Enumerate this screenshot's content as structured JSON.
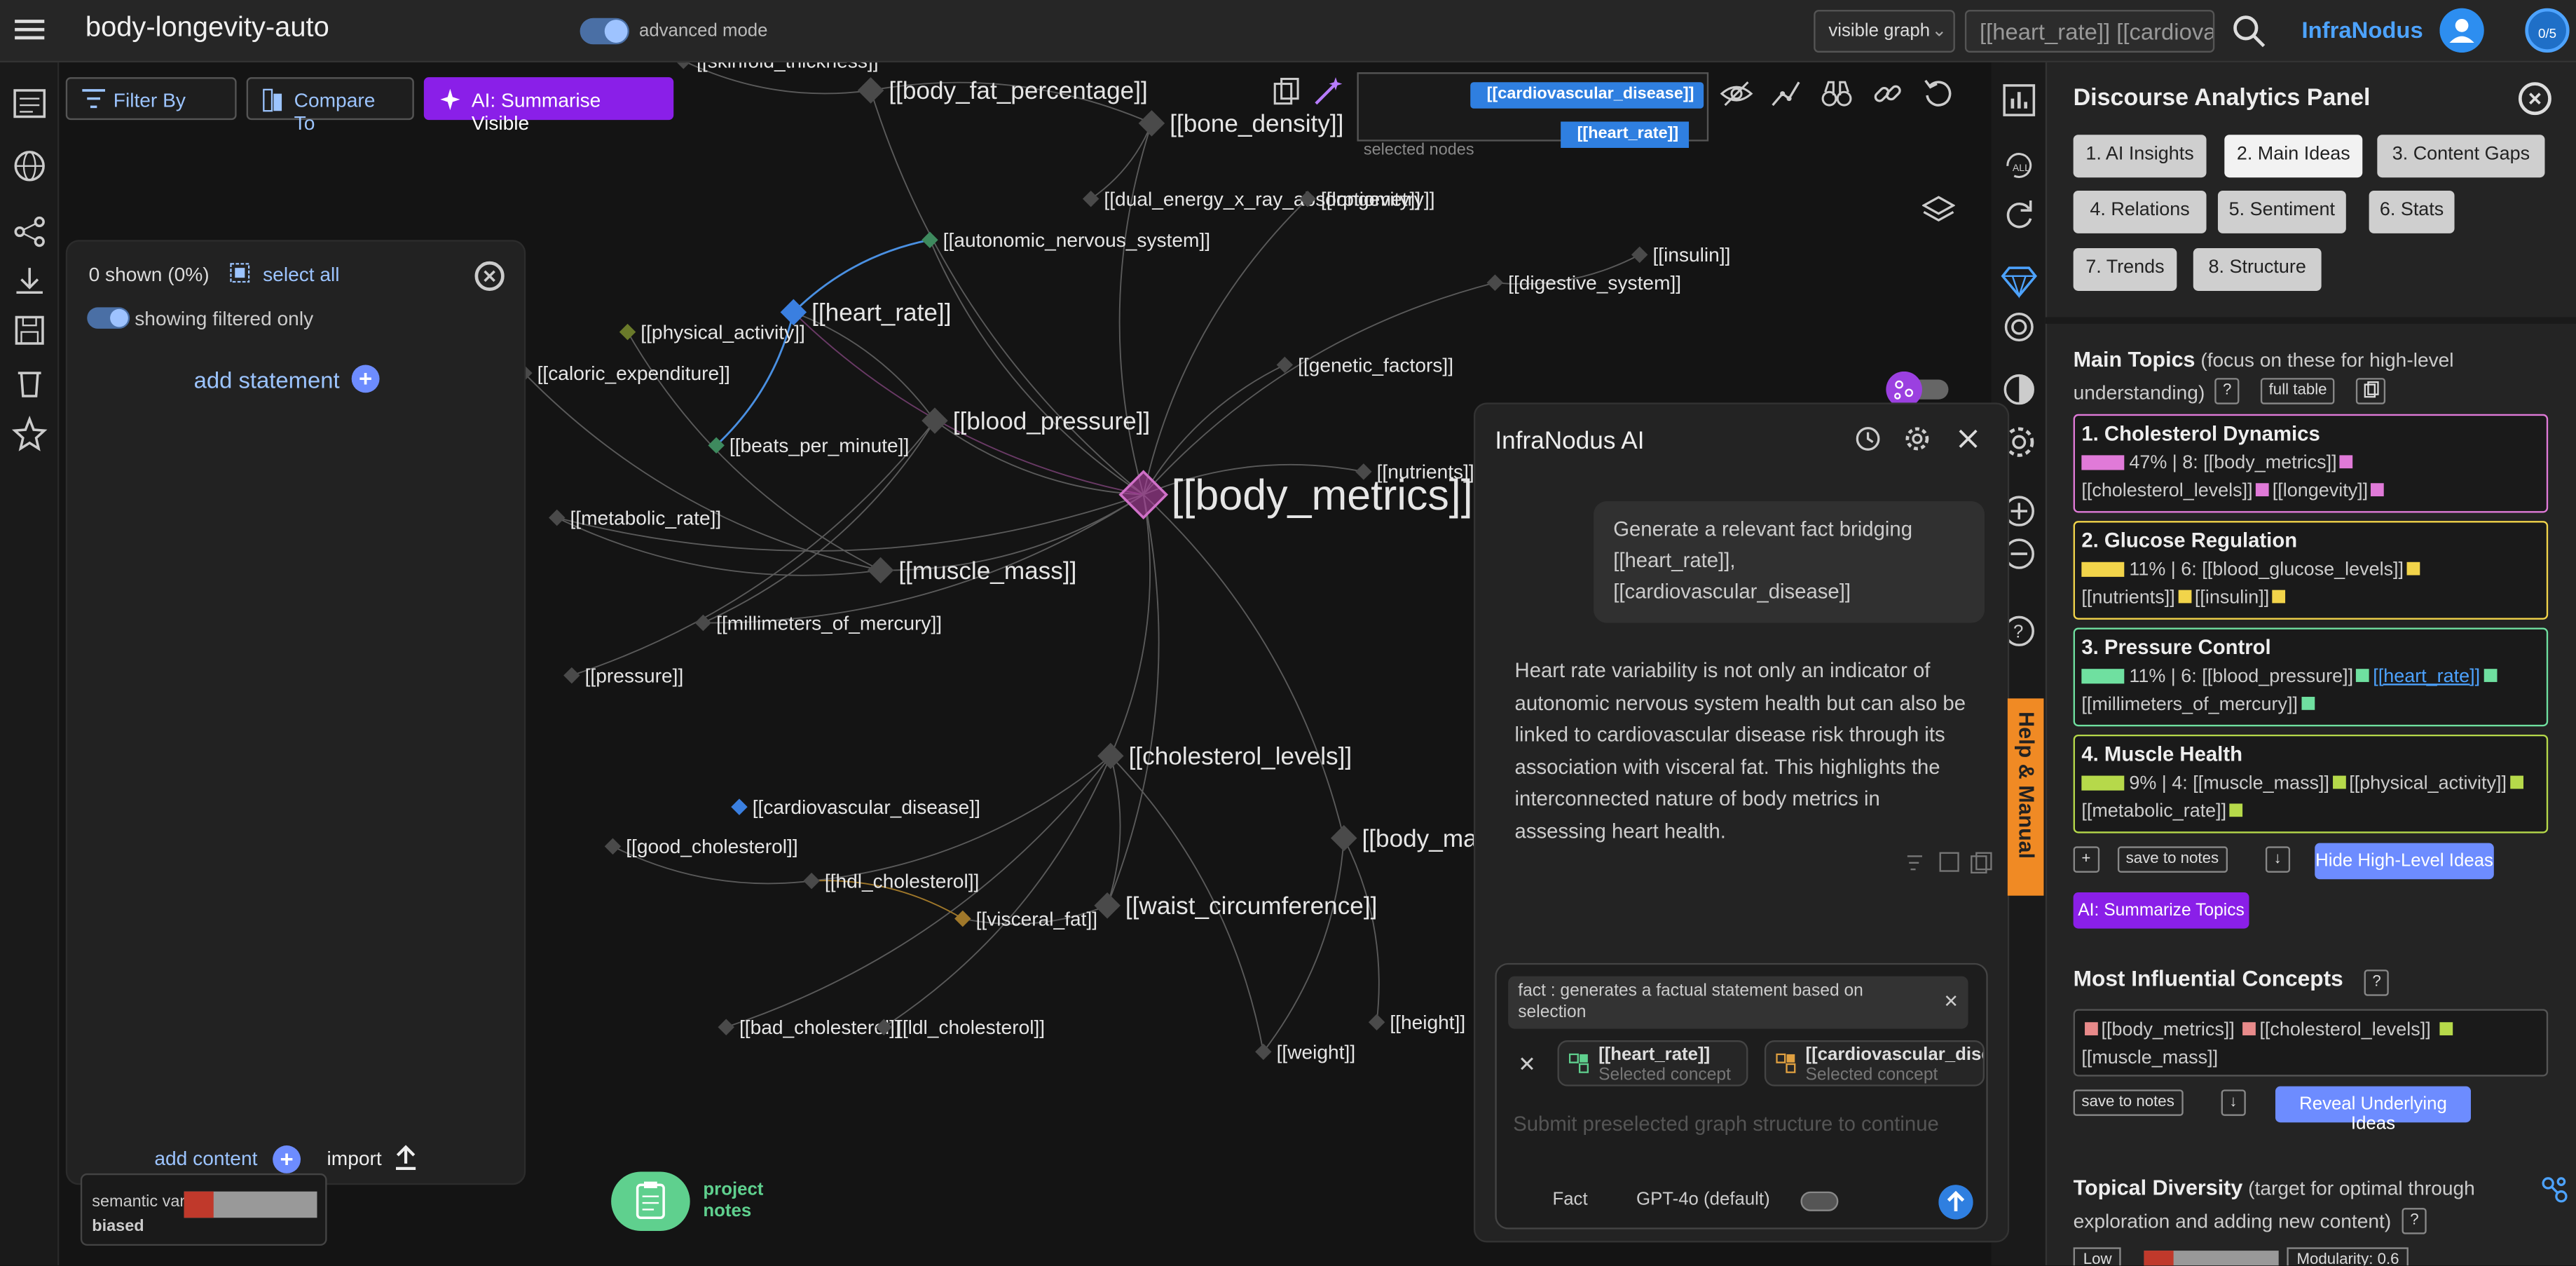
{
  "topbar": {
    "project_name": "body-longevity-auto",
    "advanced_mode_label": "advanced mode",
    "view_select": "visible graph",
    "search_value": "[[heart_rate]] [[cardiovascular_disease]]",
    "brand": "InfraNodus",
    "counter": "0/5"
  },
  "toolbar": {
    "filter_label": "Filter By",
    "compare_label": "Compare To",
    "summarise_label": "AI: Summarise Visible"
  },
  "statements": {
    "shown_count": "0 shown (0%)",
    "select_all": "select all",
    "filtered_label": "showing filtered only",
    "add_statement": "add statement",
    "add_content": "add content",
    "import": "import",
    "variability_label": "semantic variability:",
    "variability_value": "biased",
    "variability_level": 0.22
  },
  "project_notes": "project notes",
  "selected_nodes": {
    "label": "selected nodes",
    "chips": [
      "[[cardiovascular_disease]]",
      "[[heart_rate]]"
    ]
  },
  "graph": {
    "nodes": [
      {
        "label": "[[body_metrics]]",
        "color": "#b03fa2",
        "size": "xl"
      },
      {
        "label": "[[cholesterol_levels]]",
        "color": "#4a4a4a",
        "size": "l"
      },
      {
        "label": "[[muscle_mass]]",
        "color": "#4a4a4a",
        "size": "l"
      },
      {
        "label": "[[blood_pressure]]",
        "color": "#4a4a4a",
        "size": "l"
      },
      {
        "label": "[[heart_rate]]",
        "color": "#3a7fe0",
        "size": "l"
      },
      {
        "label": "[[body_fat_percentage]]",
        "color": "#4a4a4a",
        "size": "l"
      },
      {
        "label": "[[bone_density]]",
        "color": "#4a4a4a",
        "size": "l"
      },
      {
        "label": "[[waist_circumference]]",
        "color": "#4a4a4a",
        "size": "l"
      },
      {
        "label": "[[body_ma",
        "color": "#4a4a4a",
        "size": "l"
      },
      {
        "label": "[[skinfold_thickness]]",
        "color": "#4a4a4a",
        "size": "s"
      },
      {
        "label": "[[dual_energy_x_ray_absorptiometry]]",
        "color": "#4a4a4a",
        "size": "s"
      },
      {
        "label": "[[longevity]]",
        "color": "#4a4a4a",
        "size": "s"
      },
      {
        "label": "[[autonomic_nervous_system]]",
        "color": "#3e8a5e",
        "size": "s"
      },
      {
        "label": "[[insulin]]",
        "color": "#4a4a4a",
        "size": "s"
      },
      {
        "label": "[[digestive_system]]",
        "color": "#4a4a4a",
        "size": "s"
      },
      {
        "label": "[[physical_activity]]",
        "color": "#6a7a2a",
        "size": "s"
      },
      {
        "label": "[[caloric_expenditure]]",
        "color": "#4a4a4a",
        "size": "s"
      },
      {
        "label": "[[genetic_factors]]",
        "color": "#4a4a4a",
        "size": "s"
      },
      {
        "label": "[[beats_per_minute]]",
        "color": "#3e8a5e",
        "size": "s"
      },
      {
        "label": "[[nutrients]]",
        "color": "#4a4a4a",
        "size": "s"
      },
      {
        "label": "[[metabolic_rate]]",
        "color": "#4a4a4a",
        "size": "s"
      },
      {
        "label": "[[millimeters_of_mercury]]",
        "color": "#4a4a4a",
        "size": "s"
      },
      {
        "label": "[[pressure]]",
        "color": "#4a4a4a",
        "size": "s"
      },
      {
        "label": "[[cardiovascular_disease]]",
        "color": "#3a7fe0",
        "size": "s"
      },
      {
        "label": "[[good_cholesterol]]",
        "color": "#4a4a4a",
        "size": "s"
      },
      {
        "label": "[[hdl_cholesterol]]",
        "color": "#4a4a4a",
        "size": "s"
      },
      {
        "label": "[[visceral_fat]]",
        "color": "#a0782a",
        "size": "s"
      },
      {
        "label": "[[bad_cholesterol]]",
        "color": "#4a4a4a",
        "size": "s"
      },
      {
        "label": "[[ldl_cholesterol]]",
        "color": "#4a4a4a",
        "size": "s"
      },
      {
        "label": "[[height]]",
        "color": "#4a4a4a",
        "size": "s"
      },
      {
        "label": "[[weight]]",
        "color": "#4a4a4a",
        "size": "s"
      }
    ]
  },
  "ai_panel": {
    "title": "InfraNodus AI",
    "user_message": "Generate a relevant fact bridging [[heart_rate]], [[cardiovascular_disease]]",
    "response": "Heart rate variability is not only an indicator of autonomic nervous system health but can also be linked to cardiovascular disease risk through its association with visceral fat. This highlights the interconnected nature of body metrics in assessing heart health.",
    "mode_chip": "fact : generates a factual statement based on selection",
    "concepts": [
      {
        "name": "[[heart_rate]]",
        "sub": "Selected concept"
      },
      {
        "name": "[[cardiovascular_disease]]",
        "sub": "Selected concept"
      }
    ],
    "input_placeholder": "Submit preselected graph structure to continue",
    "mode_label": "Fact",
    "model_label": "GPT-4o (default)"
  },
  "help_tab": "Help & Manual",
  "analytics": {
    "title": "Discourse Analytics Panel",
    "tabs": [
      "1. AI Insights",
      "2. Main Ideas",
      "3. Content Gaps",
      "4. Relations",
      "5. Sentiment",
      "6. Stats",
      "7. Trends",
      "8. Structure"
    ],
    "main_topics_title": "Main Topics",
    "main_topics_hint": "(focus on these for high-level understanding)",
    "help_q": "?",
    "full_table": "full table",
    "topics": [
      {
        "title": "1. Cholesterol Dynamics",
        "color": "#e07ad8",
        "line1": "47% | 8: [[body_metrics]]",
        "line2": "[[cholesterol_levels]]",
        "line3": "[[longevity]]"
      },
      {
        "title": "2. Glucose Regulation",
        "color": "#f2d44a",
        "line1": "11% | 6: [[blood_glucose_levels]]",
        "line2": "[[nutrients]]",
        "line3": "[[insulin]]"
      },
      {
        "title": "3. Pressure Control",
        "color": "#6fe0a0",
        "line1": "11% | 6: [[blood_pressure]]",
        "line2": "[[heart_rate]]",
        "line3": "[[millimeters_of_mercury]]"
      },
      {
        "title": "4. Muscle Health",
        "color": "#b6d94a",
        "line1": "9% | 4: [[muscle_mass]]",
        "line2": "[[physical_activity]]",
        "line3": "[[metabolic_rate]]"
      }
    ],
    "plus": "+",
    "save_to_notes": "save to notes",
    "download": "↓",
    "hide_high_level": "Hide High-Level Ideas",
    "summarize_topics": "AI: Summarize Topics",
    "influential_title": "Most Influential Concepts",
    "influential": [
      "[[body_metrics]]",
      "[[cholesterol_levels]]",
      "[[muscle_mass]]"
    ],
    "reveal": "Reveal Underlying Ideas",
    "diversity_title": "Topical Diversity",
    "diversity_hint": "(target for optimal through exploration and adding new content)",
    "diversity_low": "Low",
    "diversity_level": 0.22,
    "modularity": "Modularity: 0.6"
  }
}
